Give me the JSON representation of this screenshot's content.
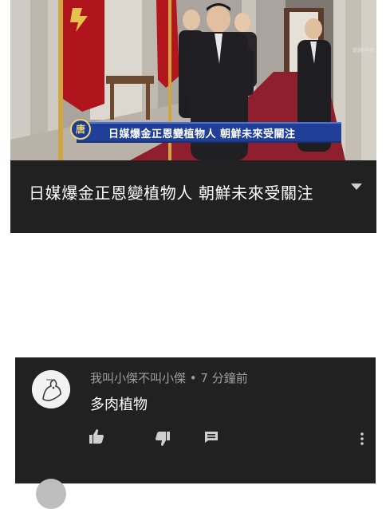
{
  "video": {
    "title": "日媒爆金正恩變植物人 朝鮮未來受關注",
    "ticker_text": "日媒爆金正恩變植物人 朝鮮未來受關注",
    "channel_logo_char": "唐",
    "watermark_text": "朝鮮中央"
  },
  "comment": {
    "author": "我叫小傑不叫小傑",
    "separator": " • ",
    "time": "7 分鐘前",
    "text": "多肉植物"
  },
  "colors": {
    "card_bg": "#212121",
    "ticker_blue": "#1f3f99",
    "meta_gray": "#9e9e9e",
    "icon_gray": "#cfcfcf"
  },
  "icons": [
    "chevron-down-icon",
    "thumbs-up-icon",
    "thumbs-down-icon",
    "reply-icon",
    "more-vert-icon"
  ]
}
